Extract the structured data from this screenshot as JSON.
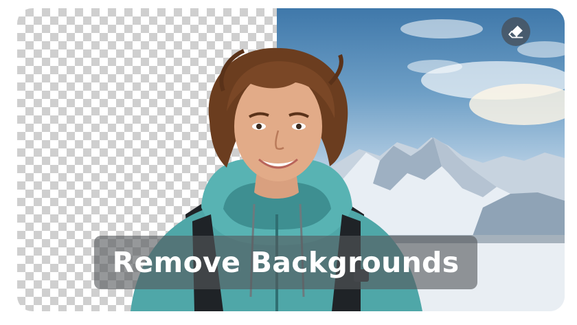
{
  "hero": {
    "caption": "Remove Backgrounds",
    "tool_icon": "eraser-icon"
  },
  "colors": {
    "checker_dark": "#cfcfcf",
    "checker_light": "#ffffff",
    "jacket": "#4fa7a8",
    "hair": "#6b3d1f",
    "caption_bg": "#55585c",
    "caption_text": "#ffffff"
  }
}
